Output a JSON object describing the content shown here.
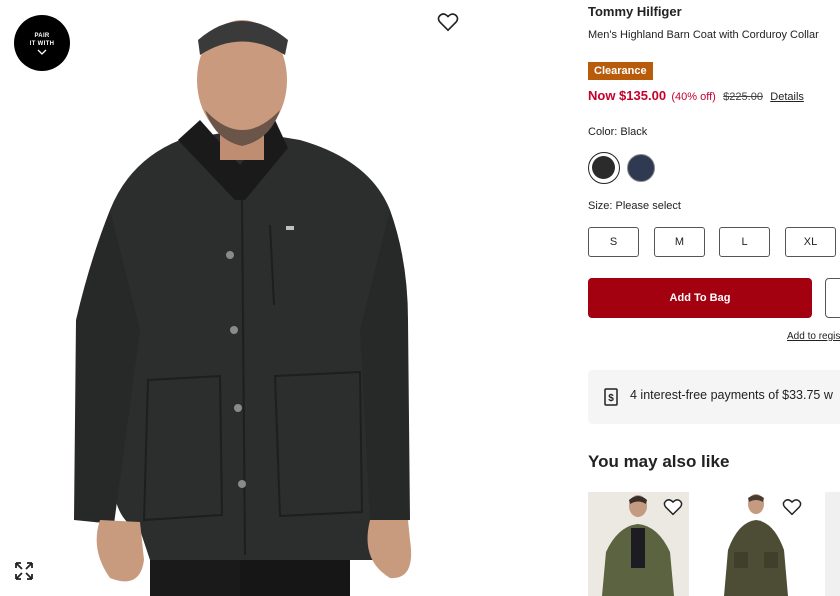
{
  "gallery": {
    "pair_with_line1": "PAIR",
    "pair_with_line2": "IT WITH",
    "icons": [
      "chevron-down-icon",
      "heart-icon",
      "expand-icon"
    ]
  },
  "product": {
    "brand": "Tommy Hilfiger",
    "name": "Men's Highland Barn Coat with Corduroy Collar",
    "badge": "Clearance",
    "price_now": "Now $135.00",
    "price_off": "(40% off)",
    "price_original": "$225.00",
    "details_link": "Details",
    "color_label": "Color: Black",
    "swatches": [
      {
        "name": "Black",
        "hex": "#2b2b2b",
        "selected": true
      },
      {
        "name": "Navy",
        "hex": "#2f3a52",
        "selected": false
      }
    ],
    "size_label": "Size: Please select",
    "sizes": [
      "S",
      "M",
      "L",
      "XL"
    ],
    "add_to_bag": "Add To Bag",
    "add_to_registry": "Add to regis",
    "payment_text": "4 interest-free payments of $33.75 w"
  },
  "recommendations": {
    "title": "You may also like"
  },
  "colors": {
    "accent_red": "#a30010",
    "sale_red": "#c4002b",
    "clearance_badge": "#b85c0b"
  }
}
